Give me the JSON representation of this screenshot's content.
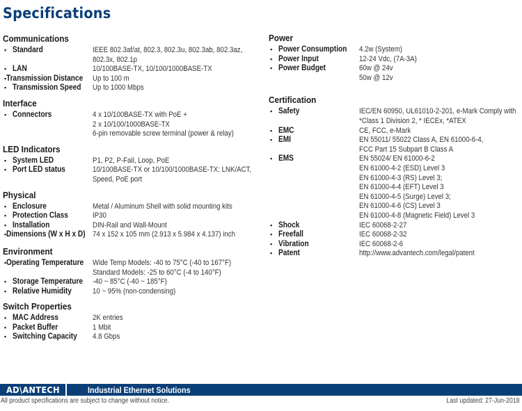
{
  "title": "Specifications",
  "left_sections": [
    {
      "heading": "Communications",
      "items": [
        {
          "key": "Standard",
          "value": [
            "IEEE 802.3af/at, 802.3, 802.3u, 802.3ab, 802.3az,",
            "802.3x, 802.1p"
          ]
        },
        {
          "key": "LAN",
          "value": [
            "10/100BASE-TX, 10/100/1000BASE-TX"
          ]
        },
        {
          "key": "Transmission Distance",
          "value": [
            "Up to 100 m"
          ]
        },
        {
          "key": "Transmission Speed",
          "value": [
            "Up to 1000 Mbps"
          ]
        }
      ]
    },
    {
      "heading": "Interface",
      "items": [
        {
          "key": "Connectors",
          "value": [
            "4 x 10/100BASE-TX with PoE +",
            "2 x 10/100/1000BASE-TX",
            "6-pin removable screw terminal (power & relay)"
          ]
        }
      ]
    },
    {
      "heading": "LED Indicators",
      "items": [
        {
          "key": "System LED",
          "value": [
            "P1, P2, P-Fail, Loop, PoE"
          ]
        },
        {
          "key": "Port LED status",
          "value": [
            "10/100BASE-TX or 10/100/1000BASE-TX: LNK/ACT,",
            "Speed, PoE port"
          ]
        }
      ]
    },
    {
      "heading": "Physical",
      "items": [
        {
          "key": "Enclosure",
          "value": [
            "Metal / Aluminum Shell with solid mounting kits"
          ]
        },
        {
          "key": "Protection Class",
          "value": [
            "IP30"
          ]
        },
        {
          "key": "Installation",
          "value": [
            "DIN-Rail and Wall-Mount"
          ]
        },
        {
          "key": "Dimensions (W x H x D)",
          "value": [
            "74 x 152 x 105 mm (2.913 x 5.984 x 4.137) inch"
          ]
        }
      ]
    },
    {
      "heading": "Environment",
      "items": [
        {
          "key": "Operating Temperature",
          "value": [
            "Wide Temp Models: -40 to 75°C (-40 to 167°F)",
            "Standard Models: -25 to 60°C (-4 to 140°F)"
          ]
        },
        {
          "key": "Storage Temperature",
          "value": [
            "-40 ~ 85°C (-40 ~ 185°F)"
          ]
        },
        {
          "key": "Relative Humidity",
          "value": [
            "10 ~ 95% (non-condensing)"
          ]
        }
      ]
    },
    {
      "heading": "Switch Properties",
      "items": [
        {
          "key": "MAC Address",
          "value": [
            "2K entries"
          ]
        },
        {
          "key": "Packet Buffer",
          "value": [
            "1 Mbit"
          ]
        },
        {
          "key": "Switching Capacity",
          "value": [
            "4.8 Gbps"
          ]
        }
      ]
    }
  ],
  "right_sections": [
    {
      "heading": "Power",
      "items": [
        {
          "key": "Power Consumption",
          "value": [
            "4.2w (System)"
          ]
        },
        {
          "key": "Power Input",
          "value": [
            "12-24 Vdc, (7A-3A)"
          ]
        },
        {
          "key": "Power Budget",
          "value": [
            "60w @ 24v",
            "50w @ 12v"
          ]
        }
      ]
    },
    {
      "heading": "Certification",
      "items": [
        {
          "key": "Safety",
          "value": [
            "IEC/EN 60950, UL61010-2-201, e-Mark Comply with",
            "*Class 1 Division 2, * IECEx, *ATEX"
          ]
        },
        {
          "key": "EMC",
          "value": [
            "CE, FCC, e-Mark"
          ]
        },
        {
          "key": "EMI",
          "value": [
            "EN 55011/ 55022 Class A, EN 61000-6-4,",
            "FCC Part 15 Subpart B Class A"
          ]
        },
        {
          "key": "EMS",
          "value": [
            "EN 55024/ EN 61000-6-2",
            "EN 61000-4-2 (ESD) Level 3",
            "EN 61000-4-3 (RS) Level 3;",
            "EN 61000-4-4 (EFT) Level 3",
            "EN 61000-4-5 (Surge) Level 3;",
            "EN 61000-4-6 (CS) Level 3",
            "EN 61000-4-8 (Magnetic Field) Level 3"
          ]
        },
        {
          "key": "Shock",
          "value": [
            "IEC 60068-2-27"
          ]
        },
        {
          "key": "Freefall",
          "value": [
            "IEC 60068-2-32"
          ]
        },
        {
          "key": "Vibration",
          "value": [
            "IEC 60068-2-6"
          ]
        },
        {
          "key": "Patent",
          "value": [
            "http://www.advantech.com/legal/patent"
          ]
        }
      ]
    }
  ],
  "footer": {
    "logo": "AD\\ANTECH",
    "tagline": "Industrial Ethernet Solutions",
    "note": "All product specifications are subject to change without notice.",
    "last_updated": "Last updated: 27-Jun-2018"
  },
  "colors": {
    "brand_blue": "#0b3f78"
  }
}
